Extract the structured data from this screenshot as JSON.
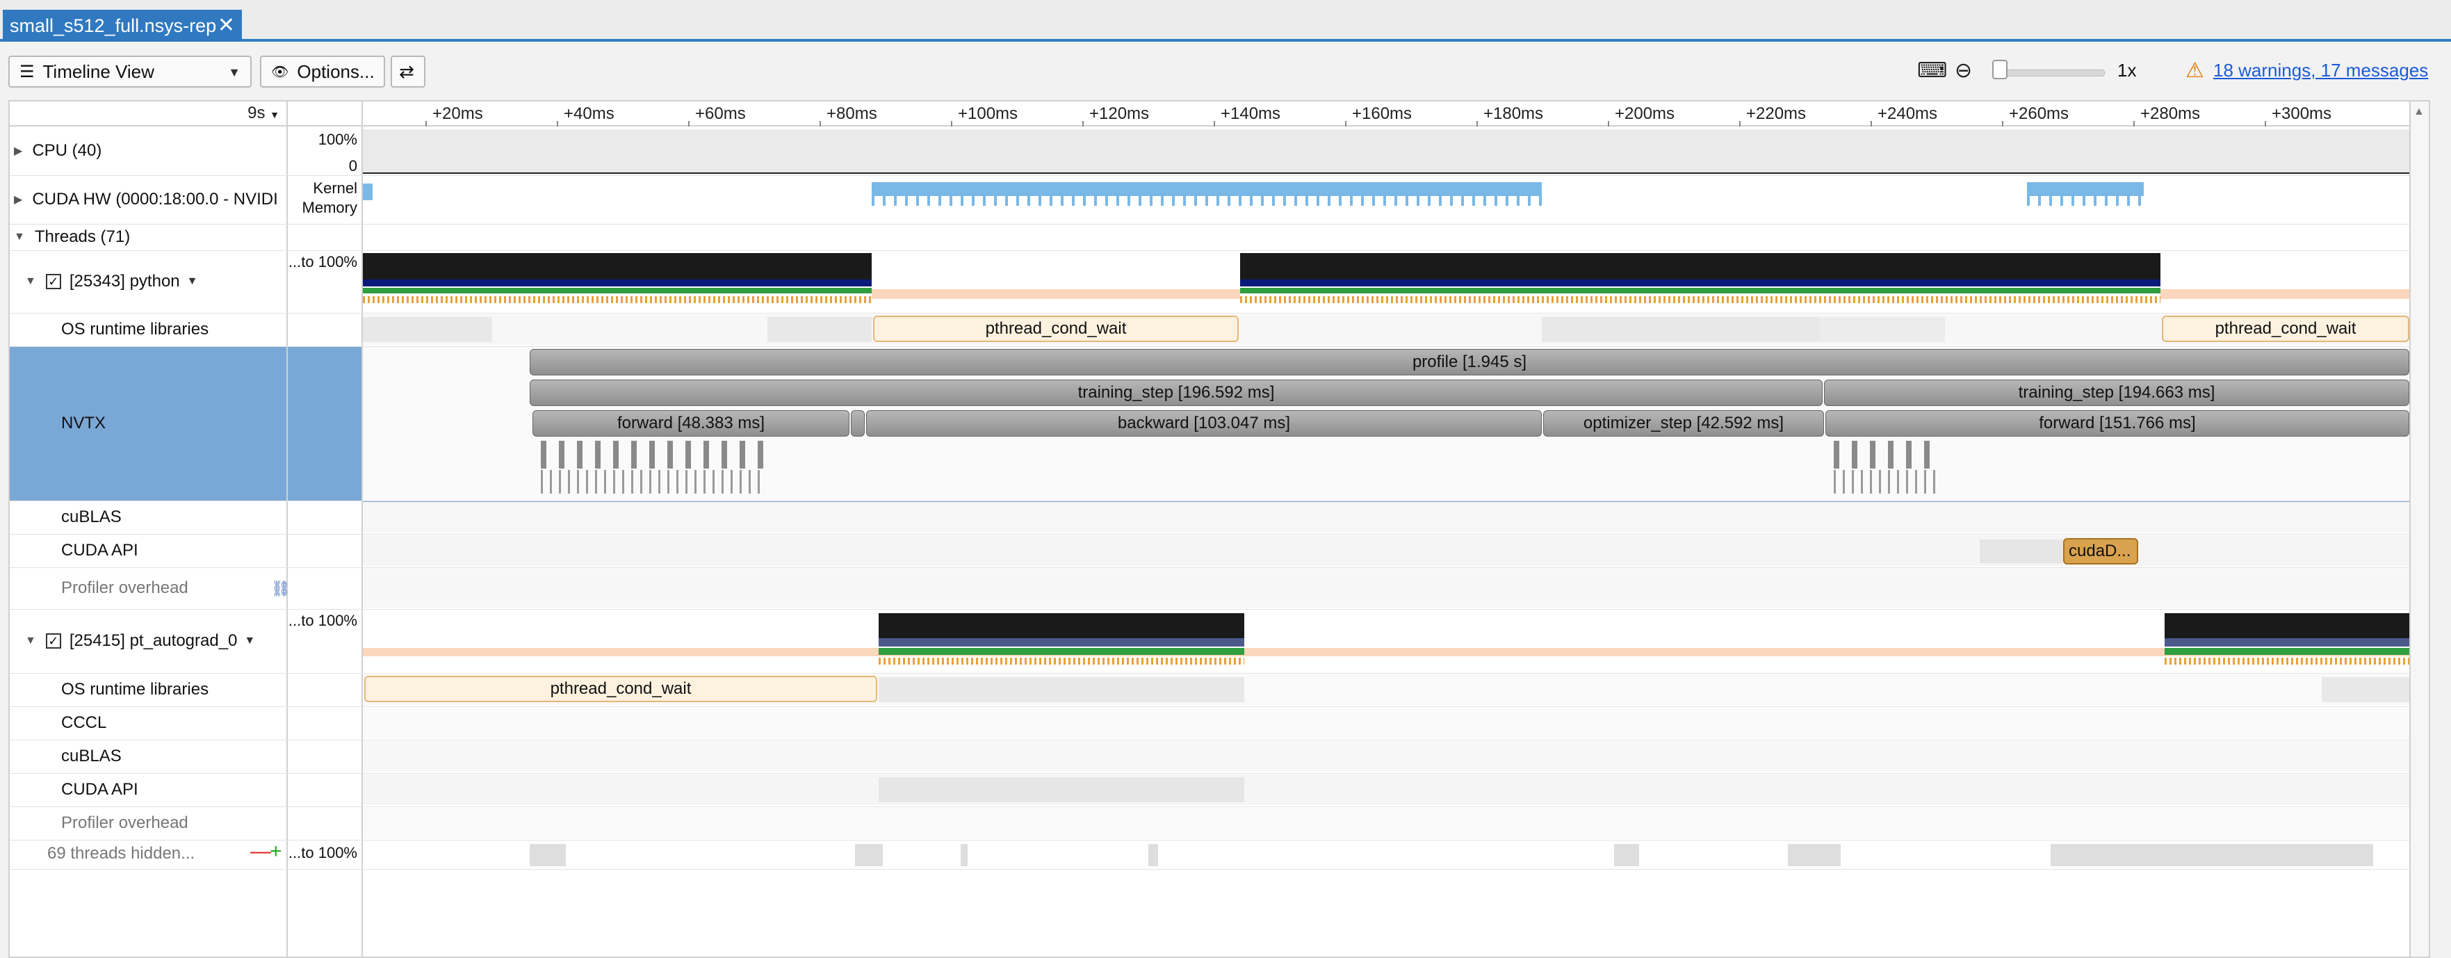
{
  "tab": {
    "title": "small_s512_full.nsys-rep",
    "close": "✕"
  },
  "toolbar": {
    "view_label": "Timeline View",
    "view_icon": "☰",
    "options_label": "Options...",
    "options_icon": "👁",
    "swap_icon": "⇄",
    "keyboard_icon": "⌨",
    "zoom_out_icon": "⊖",
    "zoom_level": "1x",
    "warning_icon": "⚠",
    "warnings_text": "18 warnings, 17 messages"
  },
  "timeline": {
    "range_label": "9s",
    "ticks": [
      "+20ms",
      "+40ms",
      "+60ms",
      "+80ms",
      "+100ms",
      "+120ms",
      "+140ms",
      "+160ms",
      "+180ms",
      "+200ms",
      "+220ms",
      "+240ms",
      "+260ms",
      "+280ms",
      "+300ms"
    ]
  },
  "rows": {
    "cpu": "CPU (40)",
    "cpu_y_top": "100%",
    "cpu_y_bottom": "0",
    "cuda_hw": "CUDA HW (0000:18:00.0 - NVIDI",
    "cuda_hw_y1": "Kernel",
    "cuda_hw_y2": "Memory",
    "threads": "Threads (71)",
    "python_thread": "[25343] python",
    "python_y": "...to 100%",
    "os_runtime": "OS runtime libraries",
    "nvtx": "NVTX",
    "cublas": "cuBLAS",
    "cuda_api": "CUDA API",
    "profiler_overhead": "Profiler overhead",
    "autograd_thread": "[25415] pt_autograd_0",
    "autograd_y": "...to 100%",
    "os_runtime_2": "OS runtime libraries",
    "cccl": "CCCL",
    "cublas_2": "cuBLAS",
    "cuda_api_2": "CUDA API",
    "profiler_overhead_2": "Profiler overhead",
    "hidden_threads": "69 threads hidden...",
    "hidden_minus": "—",
    "hidden_plus": "+",
    "hidden_y": "...to 100%",
    "checked": "✓"
  },
  "events": {
    "profile": "profile [1.945 s]",
    "training_step_1": "training_step [196.592 ms]",
    "training_step_2": "training_step [194.663 ms]",
    "forward_1": "forward [48.383 ms]",
    "backward_1": "backward [103.047 ms]",
    "optimizer_step_1": "optimizer_step [42.592 ms]",
    "forward_2": "forward [151.766 ms]",
    "pthread_1": "pthread_cond_wait",
    "pthread_2": "pthread_cond_wait",
    "pthread_3": "pthread_cond_wait",
    "cuda_call": "cudaD..."
  },
  "colors": {
    "tab_blue": "#3079c0",
    "nvtx_selected": "#7aa8d6",
    "thread_black": "#1a1a1a",
    "thread_navy": "#0d1a7a",
    "thread_green": "#2e9e3e",
    "thread_orange": "#e8a13a",
    "os_peach": "#fbd7bd",
    "kernel_blue": "#7ab8e8",
    "cuda_api_orange": "#d9a24e"
  }
}
